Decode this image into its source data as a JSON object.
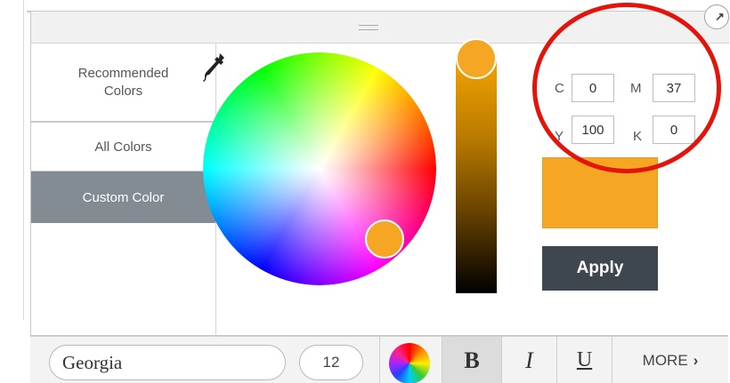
{
  "sidebar": {
    "items": [
      {
        "label": "Recommended Colors"
      },
      {
        "label": "All Colors"
      },
      {
        "label": "Custom Color"
      }
    ],
    "selected": "Custom Color"
  },
  "picker": {
    "selected_color": "#f5a623",
    "cmyk": {
      "c_label": "C",
      "c_value": "0",
      "m_label": "M",
      "m_value": "37",
      "y_label": "Y",
      "y_value": "100",
      "k_label": "K",
      "k_value": "0"
    },
    "apply_label": "Apply"
  },
  "toolbar": {
    "font_family": "Georgia",
    "font_size": "12",
    "bold_label": "B",
    "italic_label": "I",
    "underline_label": "U",
    "more_label": "MORE",
    "more_chevron": "›"
  },
  "icons": {
    "eyedropper": "eyedropper-icon",
    "close": "close-icon",
    "color_picker": "color-wheel-icon"
  },
  "colors": {
    "accent": "#f5a623",
    "nav_selected_bg": "#838b93",
    "apply_bg": "#3e464e",
    "annotation": "#e2140c"
  }
}
